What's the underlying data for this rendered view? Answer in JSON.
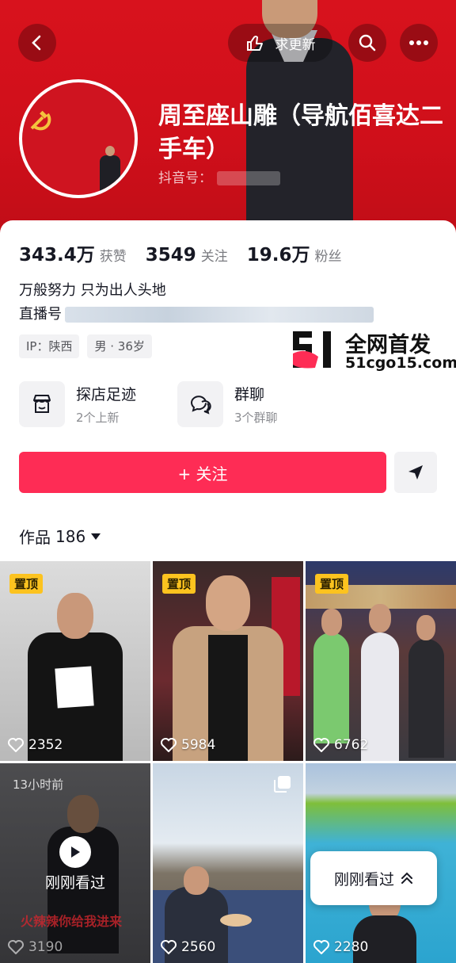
{
  "header": {
    "request_update_label": "求更新",
    "name": "周至座山雕（导航佰喜达二手车）",
    "douyin_id_label": "抖音号："
  },
  "stats": [
    {
      "value": "343.4万",
      "label": "获赞"
    },
    {
      "value": "3549",
      "label": "关注"
    },
    {
      "value": "19.6万",
      "label": "粉丝"
    }
  ],
  "bio": {
    "line1": "万般努力 只为出人头地",
    "line2_prefix": "直播号"
  },
  "tags": [
    "IP：陕西",
    "男 · 36岁"
  ],
  "watermark": {
    "logo_text": "51",
    "title": "全网首发",
    "url": "51cgo15.com"
  },
  "features": [
    {
      "title": "探店足迹",
      "subtitle": "2个上新",
      "icon": "store-icon"
    },
    {
      "title": "群聊",
      "subtitle": "3个群聊",
      "icon": "group-chat-icon"
    }
  ],
  "follow_label": "+ 关注",
  "works_tab": {
    "label": "作品",
    "count": "186"
  },
  "videos": [
    {
      "pinned": "置顶",
      "likes": "2352"
    },
    {
      "pinned": "置顶",
      "likes": "5984"
    },
    {
      "pinned": "置顶",
      "likes": "6762"
    },
    {
      "time_label": "13小时前",
      "overlay": "刚刚看过",
      "subtitle": "火辣辣你给我进来",
      "likes": "3190"
    },
    {
      "likes": "2560"
    },
    {
      "likes": "2280"
    }
  ],
  "recently_watched_label": "刚刚看过",
  "colors": {
    "brand_red": "#fe2c55",
    "header_red": "#d8121d",
    "pin_yellow": "#fcc31f"
  }
}
